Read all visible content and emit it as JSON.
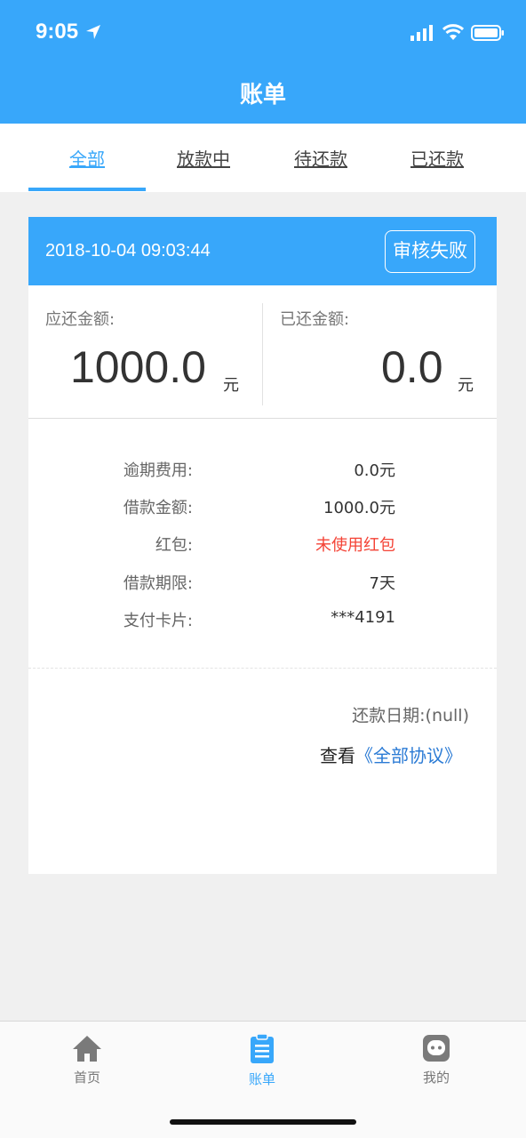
{
  "status_bar": {
    "time": "9:05"
  },
  "header": {
    "title": "账单"
  },
  "tabs": [
    {
      "label": "全部",
      "active": true
    },
    {
      "label": "放款中",
      "active": false
    },
    {
      "label": "待还款",
      "active": false
    },
    {
      "label": "已还款",
      "active": false
    }
  ],
  "bill": {
    "datetime": "2018-10-04 09:03:44",
    "status": "审核失败",
    "due": {
      "label": "应还金额:",
      "value": "1000.0",
      "unit": "元"
    },
    "paid": {
      "label": "已还金额:",
      "value": "0.0",
      "unit": "元"
    },
    "details": [
      {
        "label": "逾期费用:",
        "value": "0.0元"
      },
      {
        "label": "借款金额:",
        "value": "1000.0元"
      },
      {
        "label": "红包:",
        "value": "未使用红包"
      },
      {
        "label": "借款期限:",
        "value": "7天"
      },
      {
        "label": "支付卡片:",
        "value": "***4191"
      }
    ],
    "repay_date_label": "还款日期:",
    "repay_date_value": "(null)",
    "agreement_prefix": "查看",
    "agreement_link": "《全部协议》"
  },
  "tabbar": [
    {
      "label": "首页",
      "icon": "home-icon"
    },
    {
      "label": "账单",
      "icon": "bill-icon"
    },
    {
      "label": "我的",
      "icon": "profile-icon"
    }
  ],
  "colors": {
    "primary": "#38a7fa",
    "highlight": "#f44336",
    "link": "#2b7bd5"
  }
}
